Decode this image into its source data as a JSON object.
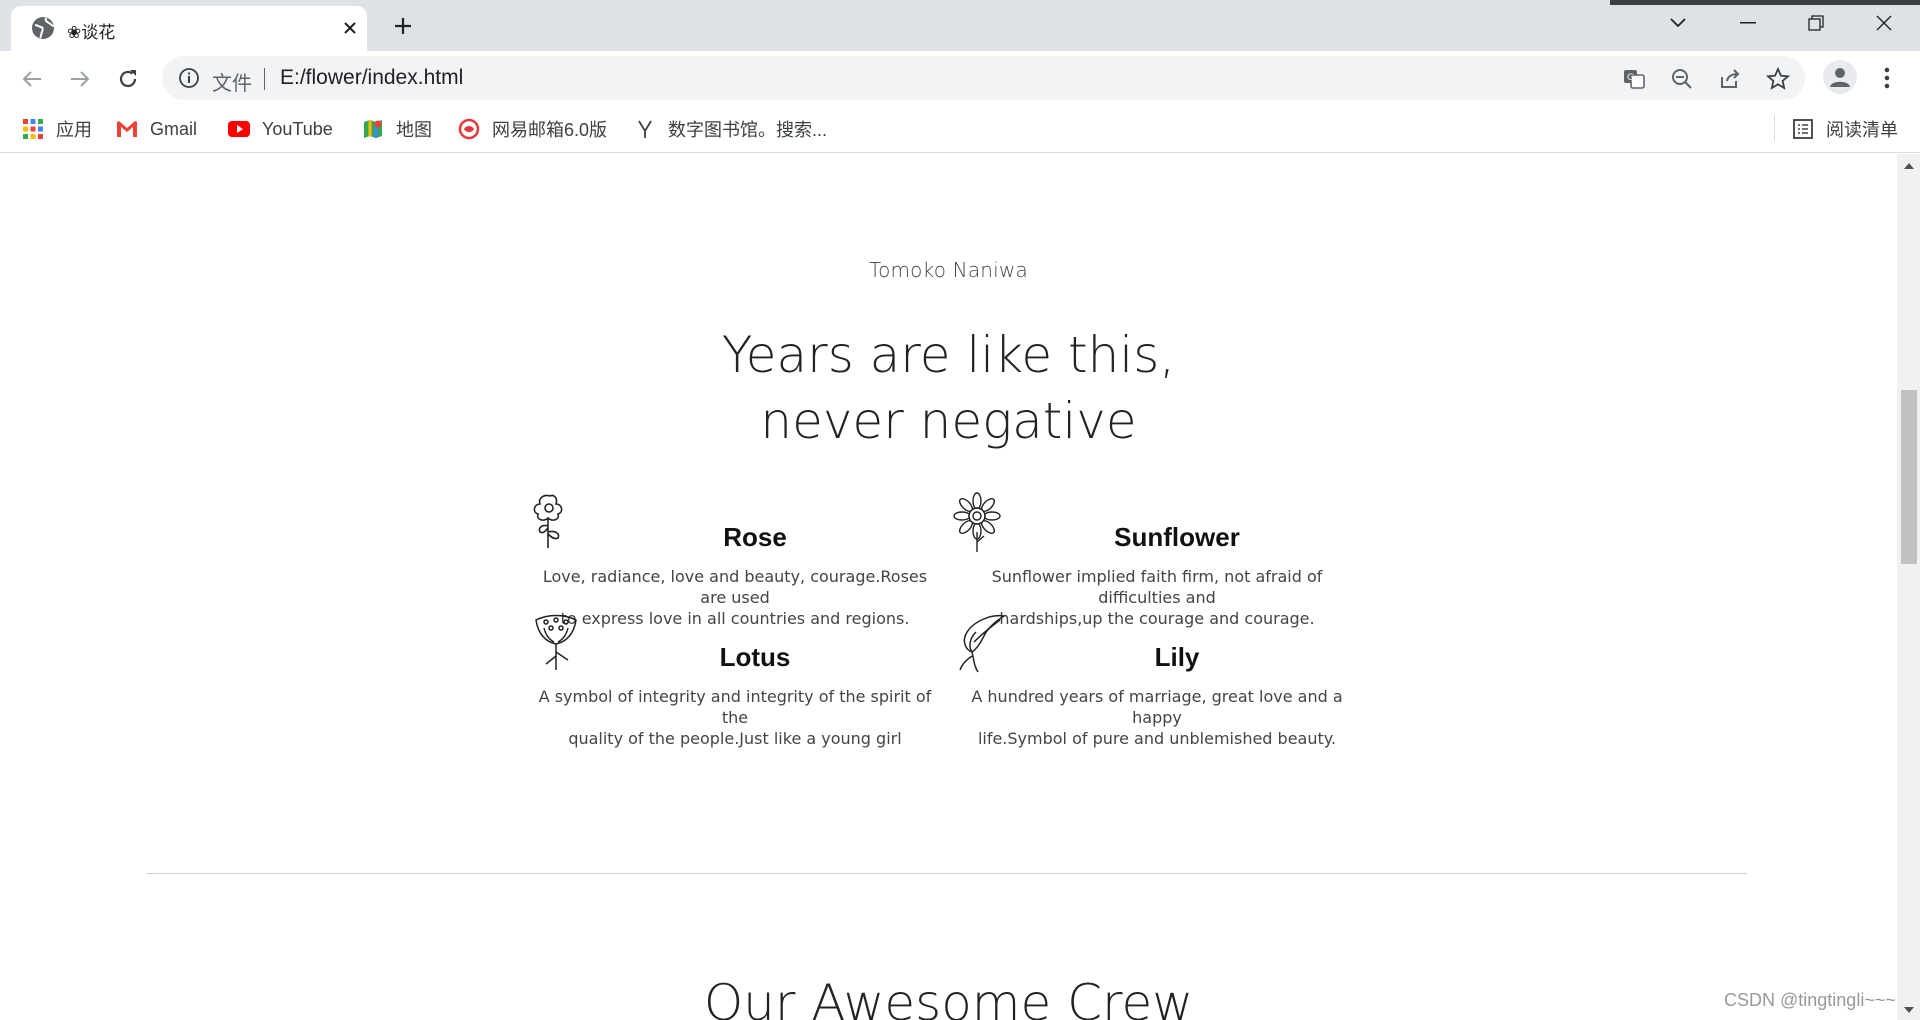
{
  "browser": {
    "tab_title": "❀谈花",
    "url_protocol": "文件",
    "url": "E:/flower/index.html",
    "bookmarks": [
      {
        "label": "应用",
        "icon": "apps-grid-icon"
      },
      {
        "label": "Gmail",
        "icon": "gmail-icon"
      },
      {
        "label": "YouTube",
        "icon": "youtube-icon"
      },
      {
        "label": "地图",
        "icon": "maps-icon"
      },
      {
        "label": "网易邮箱6.0版",
        "icon": "netease-mail-icon"
      },
      {
        "label": "数字图书馆。搜索...",
        "icon": "library-icon"
      }
    ],
    "reading_list": "阅读清单"
  },
  "page": {
    "author": "Tomoko Naniwa",
    "headline_line1": "Years are like this,",
    "headline_line2": "never negative",
    "flowers": [
      {
        "name": "Rose",
        "desc_line1": "Love, radiance, love and beauty, courage.Roses are used",
        "desc_line2": "to express love in all countries and regions.",
        "icon": "rose-icon"
      },
      {
        "name": "Sunflower",
        "desc_line1": "Sunflower implied faith firm, not afraid of difficulties and",
        "desc_line2": "hardships,up the courage and courage.",
        "icon": "sunflower-icon"
      },
      {
        "name": "Lotus",
        "desc_line1": "A symbol of integrity and integrity of the spirit of the",
        "desc_line2": "quality of the people.Just like a young girl",
        "icon": "lotus-icon"
      },
      {
        "name": "Lily",
        "desc_line1": "A hundred years of marriage, great love and a happy",
        "desc_line2": "life.Symbol of pure and unblemished beauty.",
        "icon": "lily-icon"
      }
    ],
    "crew_heading": "Our Awesome Crew"
  },
  "watermark": "CSDN @tingtingli~~~",
  "colors": {
    "tabstrip": "#dee1e6",
    "omnibox": "#f1f3f4",
    "text_dark": "#222222"
  }
}
